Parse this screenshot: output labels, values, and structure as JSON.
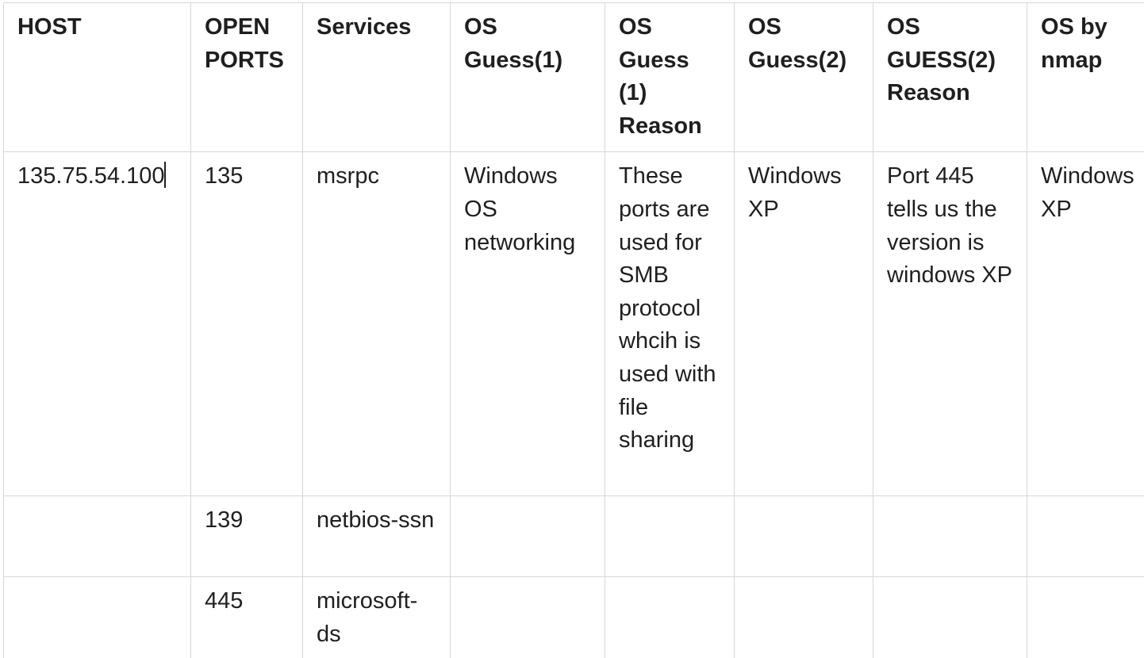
{
  "table": {
    "headers": [
      "HOST",
      "OPEN PORTS",
      "Services",
      "OS Guess(1)",
      "OS Guess (1) Reason",
      "OS Guess(2)",
      "OS GUESS(2) Reason",
      "OS by nmap"
    ],
    "rows": [
      [
        "135.75.54.100",
        "135",
        "msrpc",
        "Windows OS networking",
        "These ports are used for SMB protocol whcih is used with file sharing",
        "Windows XP",
        "Port 445 tells us the version is windows XP",
        "Windows XP"
      ],
      [
        "",
        "139",
        "netbios-ssn",
        "",
        "",
        "",
        "",
        ""
      ],
      [
        "",
        "445",
        "microsoft-ds",
        "",
        "",
        "",
        "",
        ""
      ]
    ]
  }
}
